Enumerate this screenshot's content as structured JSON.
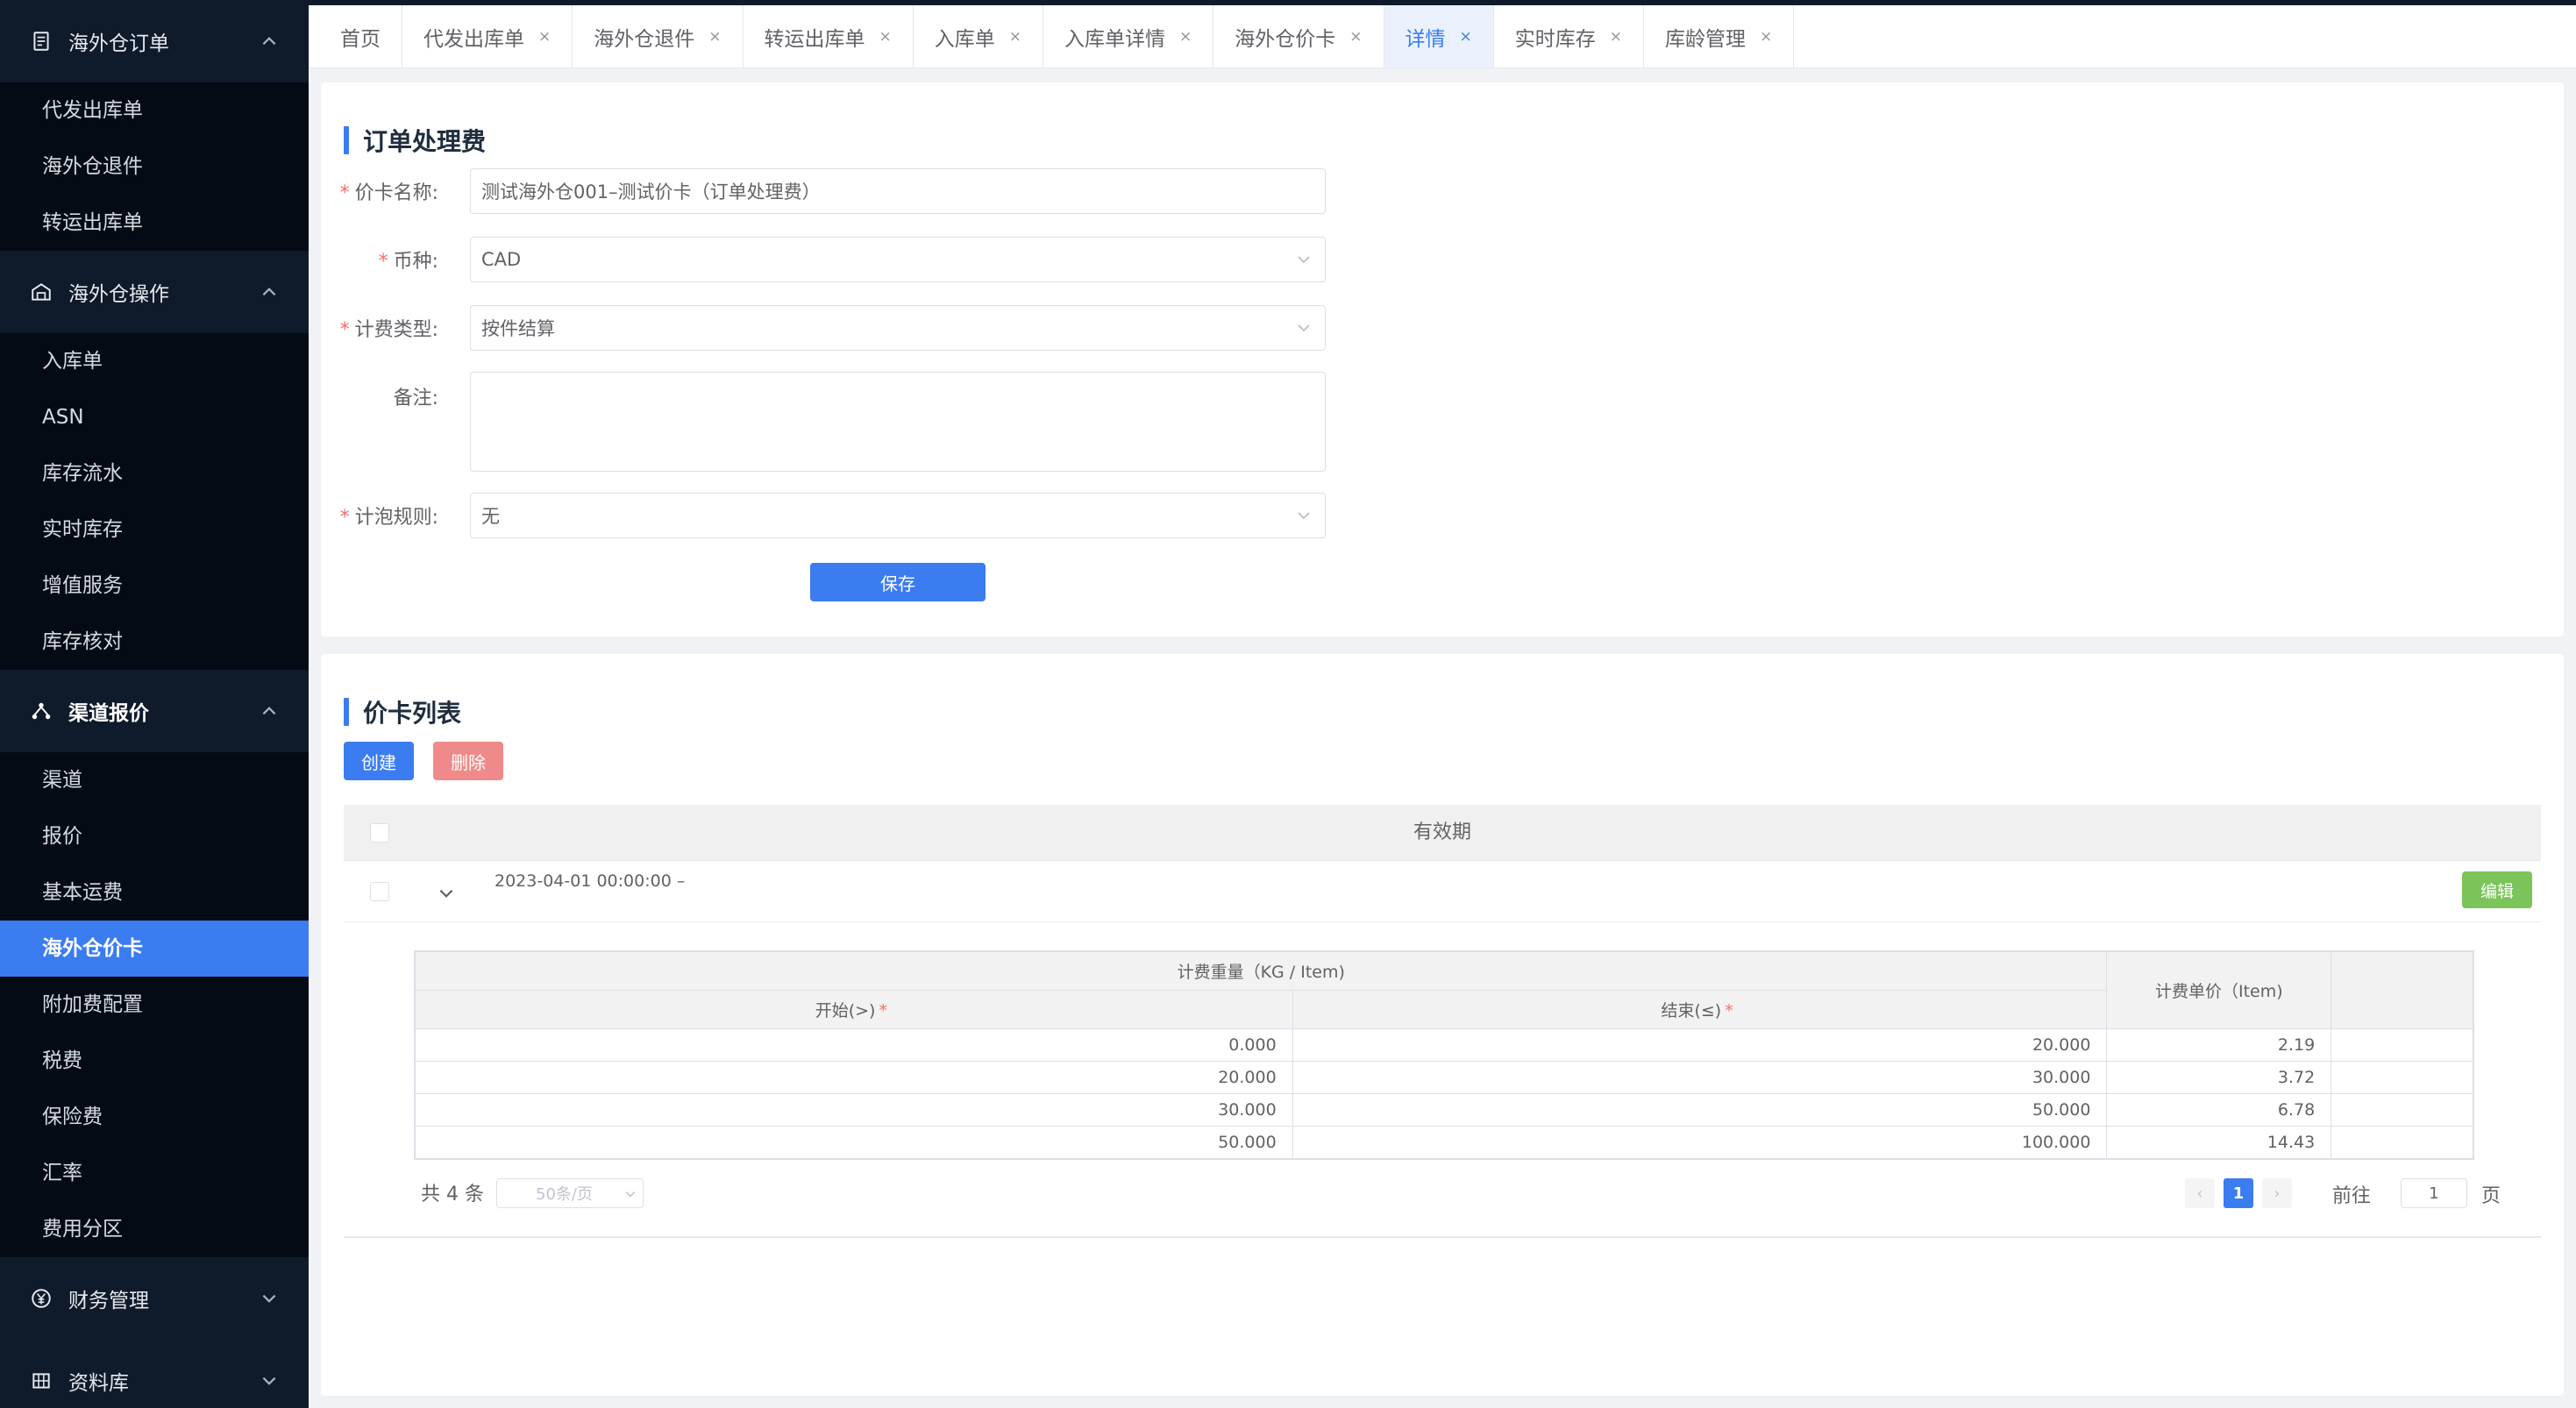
{
  "sidebar": {
    "groups": [
      {
        "label": "海外仓订单",
        "icon": "document-icon",
        "expanded": true,
        "items": [
          "代发出库单",
          "海外仓退件",
          "转运出库单"
        ]
      },
      {
        "label": "海外仓操作",
        "icon": "warehouse-icon",
        "expanded": true,
        "items": [
          "入库单",
          "ASN",
          "库存流水",
          "实时库存",
          "增值服务",
          "库存核对"
        ]
      },
      {
        "label": "渠道报价",
        "icon": "network-icon",
        "expanded": true,
        "items": [
          "渠道",
          "报价",
          "基本运费",
          "海外仓价卡",
          "附加费配置",
          "税费",
          "保险费",
          "汇率",
          "费用分区"
        ]
      },
      {
        "label": "财务管理",
        "icon": "yen-circle-icon",
        "expanded": false,
        "items": []
      },
      {
        "label": "资料库",
        "icon": "grid-icon",
        "expanded": false,
        "items": []
      }
    ],
    "active_item": "海外仓价卡"
  },
  "tabs": [
    {
      "label": "首页",
      "closable": false
    },
    {
      "label": "代发出库单",
      "closable": true
    },
    {
      "label": "海外仓退件",
      "closable": true
    },
    {
      "label": "转运出库单",
      "closable": true
    },
    {
      "label": "入库单",
      "closable": true
    },
    {
      "label": "入库单详情",
      "closable": true
    },
    {
      "label": "海外仓价卡",
      "closable": true
    },
    {
      "label": "详情",
      "closable": true,
      "active": true
    },
    {
      "label": "实时库存",
      "closable": true
    },
    {
      "label": "库龄管理",
      "closable": true
    }
  ],
  "form": {
    "title": "订单处理费",
    "price_card_name": {
      "label": "价卡名称:",
      "value": "测试海外仓001–测试价卡（订单处理费）"
    },
    "currency": {
      "label": "币种:",
      "value": "CAD"
    },
    "billing_type": {
      "label": "计费类型:",
      "value": "按件结算"
    },
    "remark": {
      "label": "备注:",
      "value": ""
    },
    "bubble_rule": {
      "label": "计泡规则:",
      "value": "无"
    },
    "save_label": "保存"
  },
  "list": {
    "title": "价卡列表",
    "create_label": "创建",
    "delete_label": "删除",
    "column_validity": "有效期",
    "row": {
      "validity": "2023-04-01 00:00:00 –",
      "edit_label": "编辑"
    },
    "inner_table": {
      "group_header": "计费重量（KG / Item)",
      "col_start": "开始(>)",
      "col_end": "结束(≤)",
      "col_price": "计费单价（Item)",
      "rows": [
        {
          "start": "0.000",
          "end": "20.000",
          "price": "2.19"
        },
        {
          "start": "20.000",
          "end": "30.000",
          "price": "3.72"
        },
        {
          "start": "30.000",
          "end": "50.000",
          "price": "6.78"
        },
        {
          "start": "50.000",
          "end": "100.000",
          "price": "14.43"
        }
      ]
    },
    "pagination": {
      "total": "共 4 条",
      "page_size": "50条/页",
      "current_page": "1",
      "goto_prefix": "前往",
      "goto_value": "1",
      "goto_suffix": "页"
    }
  },
  "colors": {
    "primary": "#3b7cf0",
    "danger": "#f08a8a",
    "success": "#7bc45a",
    "sidebar_bg": "#0f1a2a"
  }
}
